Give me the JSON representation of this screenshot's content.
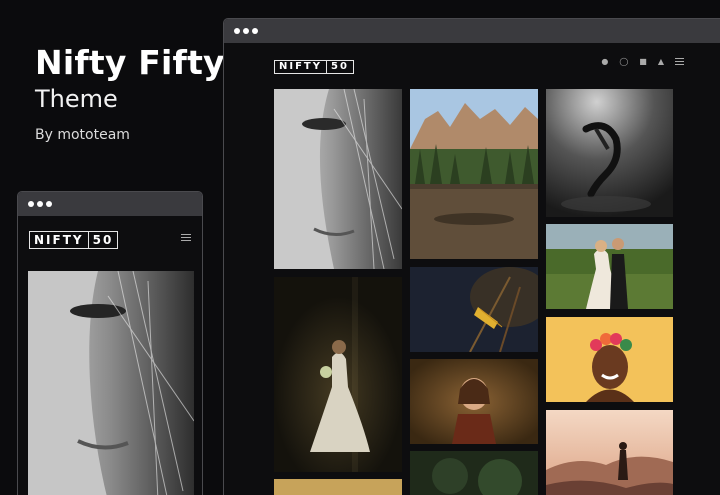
{
  "hero": {
    "title": "Nifty Fifty",
    "subtitle": "Theme",
    "byline": "By mototeam"
  },
  "desktop": {
    "logo_text": "NIFTY",
    "logo_num": "50",
    "icons": [
      "twitter-icon",
      "instagram-icon",
      "flickr-icon",
      "snapchat-icon",
      "menu-icon"
    ]
  },
  "mobile": {
    "logo_text": "NIFTY",
    "logo_num": "50"
  },
  "photos": [
    {
      "id": "freckled-woman-bw"
    },
    {
      "id": "mountain-lake"
    },
    {
      "id": "underwater-dancer-bw"
    },
    {
      "id": "wedding-couple"
    },
    {
      "id": "bride-dark-window"
    },
    {
      "id": "grasshopper-branch"
    },
    {
      "id": "woman-flower-crown"
    },
    {
      "id": "little-girl-portrait"
    },
    {
      "id": "sunset-hiker"
    }
  ]
}
